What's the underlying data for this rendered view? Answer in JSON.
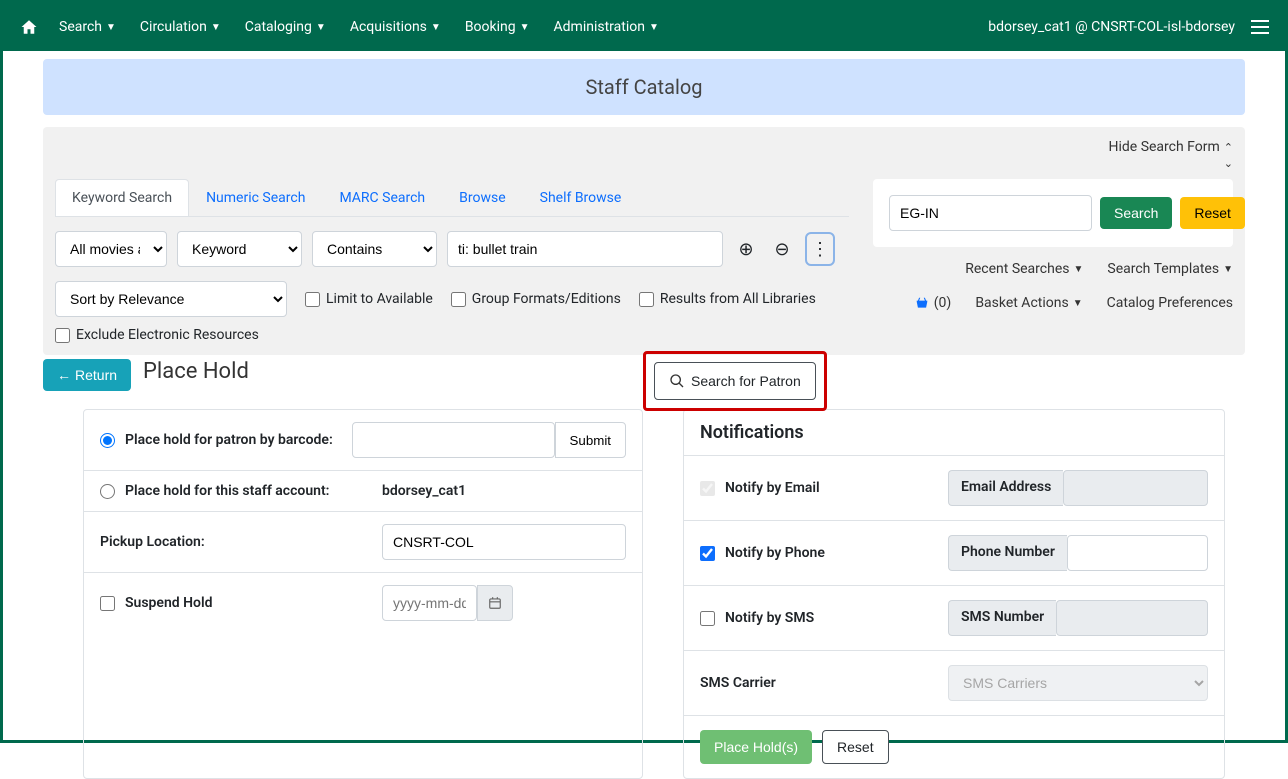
{
  "nav": {
    "items": [
      "Search",
      "Circulation",
      "Cataloging",
      "Acquisitions",
      "Booking",
      "Administration"
    ],
    "user": "bdorsey_cat1 @ CNSRT-COL-isl-bdorsey"
  },
  "banner": {
    "title": "Staff Catalog"
  },
  "search_panel": {
    "hide_label": "Hide Search Form",
    "tabs": [
      "Keyword Search",
      "Numeric Search",
      "MARC Search",
      "Browse",
      "Shelf Browse"
    ],
    "type_value": "All movies an",
    "keyword_value": "Keyword",
    "contains_value": "Contains",
    "query_value": "ti: bullet train",
    "sort_value": "Sort by Relevance",
    "limit_available_label": "Limit to Available",
    "group_formats_label": "Group Formats/Editions",
    "all_libraries_label": "Results from All Libraries",
    "exclude_label": "Exclude Electronic Resources",
    "lib_value": "EG-IN",
    "search_btn": "Search",
    "reset_btn": "Reset",
    "recent_searches": "Recent Searches",
    "search_templates": "Search Templates",
    "basket_count": "(0)",
    "basket_actions": "Basket Actions",
    "catalog_prefs": "Catalog Preferences"
  },
  "place_hold": {
    "return_btn": "Return",
    "title": "Place Hold",
    "search_patron_btn": "Search for Patron",
    "radio_barcode_label": "Place hold for patron by barcode:",
    "radio_staff_label": "Place hold for this staff account:",
    "staff_account": "bdorsey_cat1",
    "submit_label": "Submit",
    "pickup_label": "Pickup Location:",
    "pickup_value": "CNSRT-COL",
    "suspend_label": "Suspend Hold",
    "date_placeholder": "yyyy-mm-dd"
  },
  "notifications": {
    "header": "Notifications",
    "email_label": "Notify by Email",
    "email_field": "Email Address",
    "phone_label": "Notify by Phone",
    "phone_field": "Phone Number",
    "sms_label": "Notify by SMS",
    "sms_field": "SMS Number",
    "carrier_label": "SMS Carrier",
    "carrier_value": "SMS Carriers",
    "place_hold_btn": "Place Hold(s)",
    "reset_btn": "Reset"
  }
}
